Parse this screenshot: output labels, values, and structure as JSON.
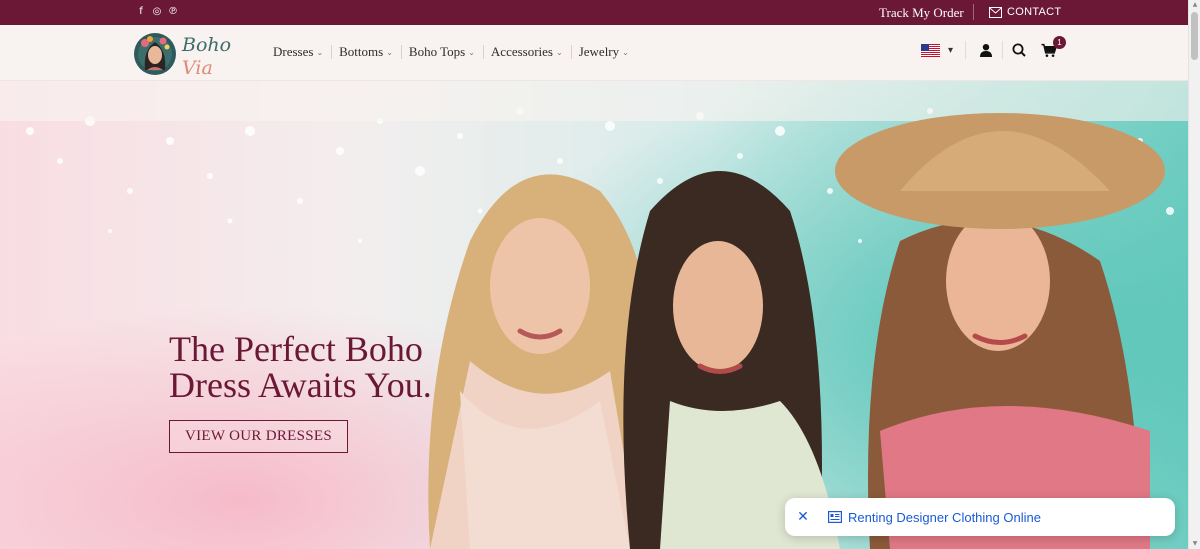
{
  "topbar": {
    "social": [
      {
        "name": "facebook-icon",
        "glyph": "f"
      },
      {
        "name": "instagram-icon",
        "glyph": "◎"
      },
      {
        "name": "pinterest-icon",
        "glyph": "℗"
      }
    ],
    "track_order": "Track My Order",
    "contact": "CONTACT",
    "bg_color": "#6b1836"
  },
  "header": {
    "logo_line1": "Boho",
    "logo_line2": "Via",
    "nav": [
      {
        "label": "Dresses"
      },
      {
        "label": "Bottoms"
      },
      {
        "label": "Boho Tops"
      },
      {
        "label": "Accessories"
      },
      {
        "label": "Jewelry"
      }
    ],
    "cart_count": "1",
    "language_caret": "▾"
  },
  "hero": {
    "headline_line1": "The Perfect Boho",
    "headline_line2": "Dress Awaits You.",
    "cta": "VIEW OUR DRESSES",
    "accent_color": "#6b1836"
  },
  "chat_popup": {
    "close": "✕",
    "label": "Renting Designer Clothing Online",
    "text_color": "#1a5bd6"
  }
}
